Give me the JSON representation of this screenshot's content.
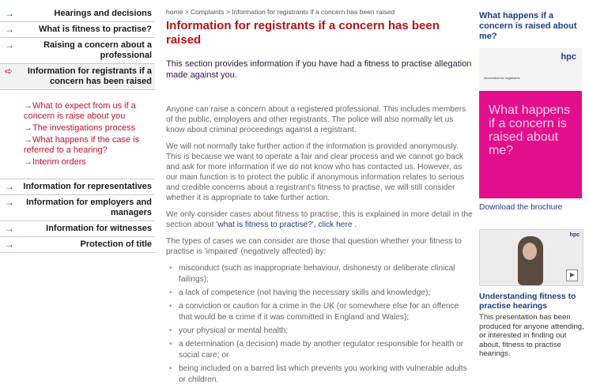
{
  "sidebar": {
    "items_top": [
      {
        "label": "Hearings and decisions"
      },
      {
        "label": "What is fitness to practise?"
      },
      {
        "label": "Raising a concern about a professional"
      },
      {
        "label": "Information for registrants if a concern has been raised"
      }
    ],
    "subitems": [
      {
        "label": "What to expect from us if a concern is raise about you"
      },
      {
        "label": "The investigations process"
      },
      {
        "label": "What happens if the case is referred to a hearing?"
      },
      {
        "label": "Interim orders"
      }
    ],
    "items_bottom": [
      {
        "label": "Information for representatives"
      },
      {
        "label": "Information for employers and managers"
      },
      {
        "label": "Information for witnesses"
      },
      {
        "label": "Protection of title"
      }
    ]
  },
  "main": {
    "breadcrumb": "home > Complaints > Information for registrants if a concern has been raised",
    "title": "Information for registrants if a concern has been raised",
    "intro": "This section provides information if you have had a fitness to practise allegation made against you.",
    "para1": "Anyone can raise a concern about a registered professional. This includes members of the public, employers and other registrants. The police will also normally let us know about criminal proceedings against a registrant.",
    "para2": "We will not normally take further action if the information is provided anonymously. This is because we want to operate a fair and clear process and we cannot go back and ask for more information if we do not know who has contacted us. However, as our main function is to protect the public if anonymous information relates to serious and credible concerns about a registrant's fitness to practise, we will still consider whether it is appropriate to take further action.",
    "para3_prefix": "We only consider cases about fitness to practise, this is explained in more detail in the section about '",
    "para3_link": "what is fitness to practise?', click here",
    "para3_suffix": " .",
    "para4": "The types of cases we can consider are those that question whether your fitness to practise is 'impaired' (negatively affected) by:",
    "bullets": [
      "misconduct (such as inappropriate behaviour, dishonesty or deliberate clinical failings);",
      "a lack of competence (not having the necessary skills and knowledge);",
      "a conviction or caution for a crime in the UK (or somewhere else for an offence that would be a crime if it was committed in England and Wales);",
      "your physical or mental health;",
      "a determination (a decision) made by another regulator responsible for health or social care; or",
      "being included on a barred list which prevents you working with vulnerable adults or children."
    ]
  },
  "right": {
    "heading": "What happens if a concern is raised about me?",
    "brochure_logo": "hpc",
    "brochure_small": "Information for registrants",
    "brochure_title": "What happens if a concern is raised about me?",
    "download_label": "Download the brochure",
    "video_logo": "hpc",
    "video_title": "Understanding fitness to practise hearings",
    "video_desc": "This presentation has been produced for anyone attending, or interested in finding out about, fitness to practise hearings."
  },
  "colors": {
    "accent_red": "#b5121b",
    "link_blue": "#1d3e8a",
    "brochure_pink": "#e30e8c"
  }
}
